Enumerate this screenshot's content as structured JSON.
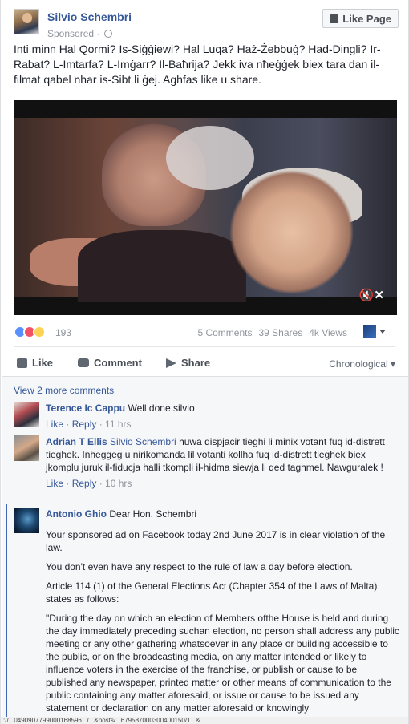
{
  "post": {
    "author": "Silvio Schembri",
    "sponsored": "Sponsored",
    "like_page": "Like Page",
    "text": "Inti minn Ħal Qormi? Is-Siġġiewi? Ħal Luqa? Ħaż-Żebbuġ? Ħad-Dingli? Ir-Rabat? L-Imtarfa? L-Imġarr? Il-Baħrija? Jekk iva nħeġġek biex tara dan il-filmat qabel nhar is-Sibt li ġej. Aghfas like u share.",
    "mute_icon": "🔇✕"
  },
  "stats": {
    "reactions_count": "193",
    "comments": "5 Comments",
    "shares": "39 Shares",
    "views": "4k Views"
  },
  "actions": {
    "like": "Like",
    "comment": "Comment",
    "share": "Share",
    "sort": "Chronological ▾"
  },
  "comments": {
    "view_more": "View 2 more comments",
    "items": [
      {
        "name": "Terence Ic Cappu",
        "text": "Well done silvio",
        "like": "Like",
        "reply": "Reply",
        "time": "11 hrs"
      },
      {
        "name": "Adrian T Ellis",
        "tag": "Silvio Schembri",
        "text": "huwa dispjacir tieghi li minix votant fuq id-distrett tieghek. Inheggeg u nirikomanda lil votanti kollha fuq id-distrett tieghek biex jkomplu juruk il-fiducja halli tkompli il-hidma siewja li qed taghmel. Nawguralek !",
        "like": "Like",
        "reply": "Reply",
        "time": "10 hrs"
      },
      {
        "name": "Antonio Ghio",
        "greeting": "Dear Hon. Schembri",
        "p1": "Your sponsored ad on Facebook today 2nd June 2017 is in clear violation of the law.",
        "p2": "You don't even have any respect to the rule of law a day before election.",
        "p3": "Article 114 (1) of the General Elections Act (Chapter 354 of the Laws of Malta) states as follows:",
        "p4": "\"During the day on which an election of Members ofthe House is held and during the day immediately preceding suchan election, no person shall address any public meeting or any other gathering whatsoever in any place or building accessible to the public, or on the broadcasting media, on any matter intended or likely to influence voters in the exercise of the franchise, or publish or cause to be published any newspaper, printed matter or other means of communication to the public containing any matter aforesaid, or issue or cause to be issued any statement or declaration on any matter aforesaid or knowingly"
      }
    ]
  },
  "status_bar": "://...0490907799000168596.../...&posts/...679587000300400150/1...&..."
}
